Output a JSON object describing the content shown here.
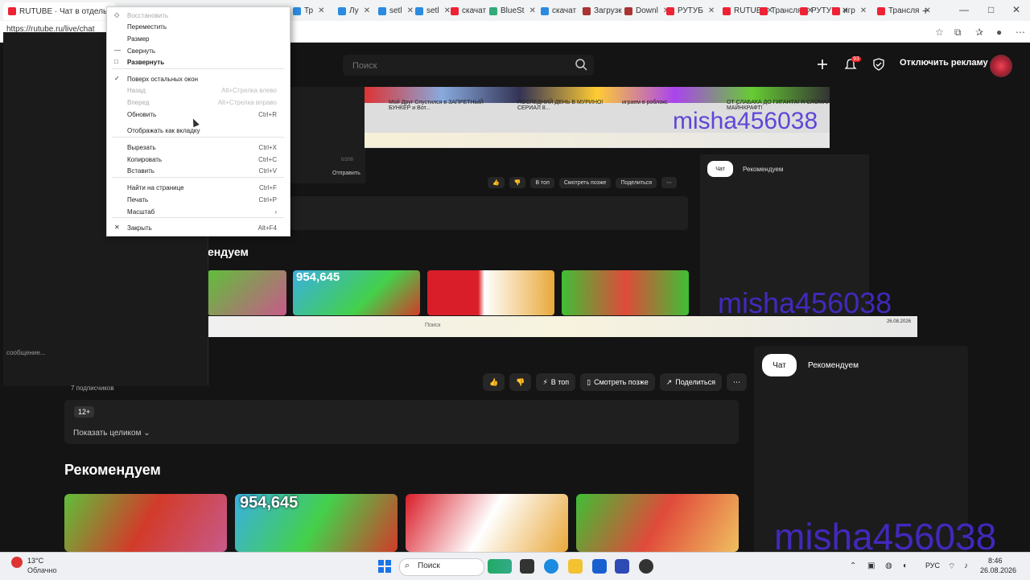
{
  "browser": {
    "url": "https://rutube.ru/live/chat",
    "active_tab_label": "RUTUBE · Чат в отдельном",
    "tabs": [
      {
        "label": "Тр",
        "color": "#2a8be0"
      },
      {
        "label": "Лу",
        "color": "#2a8be0"
      },
      {
        "label": "setl",
        "color": "#2a8be0"
      },
      {
        "label": "setl",
        "color": "#2a8be0"
      },
      {
        "label": "скачат",
        "color": "#e23"
      },
      {
        "label": "BlueSt",
        "color": "#3a7"
      },
      {
        "label": "скачат",
        "color": "#2a8be0"
      },
      {
        "label": "Загрузк",
        "color": "#a33"
      },
      {
        "label": "Downl",
        "color": "#a33"
      },
      {
        "label": "РУТУБ",
        "color": "#e23"
      },
      {
        "label": "RUTUB",
        "color": "#e23"
      },
      {
        "label": "Трансля",
        "color": "#e23"
      },
      {
        "label": "РУТУБ",
        "color": "#e23"
      },
      {
        "label": "игр",
        "color": "#e23"
      },
      {
        "label": "Трансля",
        "color": "#e23"
      }
    ],
    "new_tab": "+"
  },
  "context_menu": {
    "items": [
      {
        "label": "Восстановить",
        "shortcut": "",
        "icon": "◇",
        "disabled": true,
        "bold": false
      },
      {
        "label": "Переместить",
        "shortcut": "",
        "icon": "",
        "disabled": false,
        "bold": false
      },
      {
        "label": "Размер",
        "shortcut": "",
        "icon": "",
        "disabled": false,
        "bold": false
      },
      {
        "label": "Свернуть",
        "shortcut": "",
        "icon": "—",
        "disabled": false,
        "bold": false
      },
      {
        "label": "Развернуть",
        "shortcut": "",
        "icon": "□",
        "disabled": false,
        "bold": true
      },
      {
        "label": "Поверх остальных окон",
        "shortcut": "",
        "icon": "✓",
        "disabled": false,
        "bold": false
      },
      {
        "label": "Назад",
        "shortcut": "Alt+Стрелка влево",
        "icon": "",
        "disabled": true,
        "bold": false
      },
      {
        "label": "Вперед",
        "shortcut": "Alt+Стрелка вправо",
        "icon": "",
        "disabled": true,
        "bold": false
      },
      {
        "label": "Обновить",
        "shortcut": "Ctrl+R",
        "icon": "",
        "disabled": false,
        "bold": false
      },
      {
        "label": "Отображать как вкладку",
        "shortcut": "",
        "icon": "",
        "disabled": false,
        "bold": false
      },
      {
        "label": "Вырезать",
        "shortcut": "Ctrl+X",
        "icon": "",
        "disabled": false,
        "bold": false
      },
      {
        "label": "Копировать",
        "shortcut": "Ctrl+C",
        "icon": "",
        "disabled": false,
        "bold": false
      },
      {
        "label": "Вставить",
        "shortcut": "Ctrl+V",
        "icon": "",
        "disabled": false,
        "bold": false
      },
      {
        "label": "Найти на странице",
        "shortcut": "Ctrl+F",
        "icon": "",
        "disabled": false,
        "bold": false
      },
      {
        "label": "Печать",
        "shortcut": "Ctrl+P",
        "icon": "",
        "disabled": false,
        "bold": false
      },
      {
        "label": "Масштаб",
        "shortcut": "›",
        "icon": "",
        "disabled": false,
        "bold": false
      },
      {
        "label": "Закрыть",
        "shortcut": "Alt+F4",
        "icon": "✕",
        "disabled": false,
        "bold": false
      }
    ]
  },
  "header": {
    "search_placeholder": "Поиск",
    "notification_count": "93",
    "ad_button": "Отключить рекламу"
  },
  "inner": {
    "rec_heading": "ендуем",
    "chat_tab": "Чат",
    "rec_tab": "Рекомендуем",
    "send": "Отправить",
    "counter": "0/200",
    "buttons": [
      "В топ",
      "Смотреть позже",
      "Поделиться"
    ],
    "video_titles": [
      "Мой Друг Спустился в ЗАПРЕТНЫЙ БУНКЕР и Вот...",
      "ПОСЛЕДНИЙ ДЕНЬ В МУРИНО! СЕРИАЛ 8...",
      "играем в роблокс",
      "ОТ СЛАБАКА ДО ГИГАНТА! Я СЛОМАЛ МАЙНКРАФТ!"
    ],
    "taskbar_search": "Поиск",
    "taskbar_lang": "РУС",
    "taskbar_date": "26.08.2026",
    "thumb_badge": "954,645"
  },
  "left_panel": {
    "message_placeholder": "сообщение..."
  },
  "channel": {
    "subscribers": "7 подписчиков"
  },
  "actions": {
    "top": "В топ",
    "watch_later": "Смотреть позже",
    "share": "Поделиться"
  },
  "description": {
    "age": "12+",
    "show_full": "Показать целиком"
  },
  "chat": {
    "chat_tab": "Чат",
    "rec_tab": "Рекомендуем"
  },
  "recommended": {
    "heading": "Рекомендуем",
    "thumbs": [
      {
        "badge": "",
        "colors": [
          "#5fbf3a",
          "#d23b2a",
          "#c85a8a"
        ]
      },
      {
        "badge": "954,645",
        "colors": [
          "#3ab0e0",
          "#44d04a",
          "#d23b2a"
        ]
      },
      {
        "badge": "",
        "colors": [
          "#d91e2a",
          "#ffffff",
          "#e9a83a"
        ]
      },
      {
        "badge": "",
        "colors": [
          "#3fbf35",
          "#e04a3a",
          "#f0c060"
        ]
      }
    ]
  },
  "watermark": "misha456038",
  "taskbar": {
    "temp": "13°C",
    "weather": "Облачно",
    "search": "Поиск",
    "lang": "РУС",
    "time": "8:46",
    "date": "26.08.2026"
  }
}
